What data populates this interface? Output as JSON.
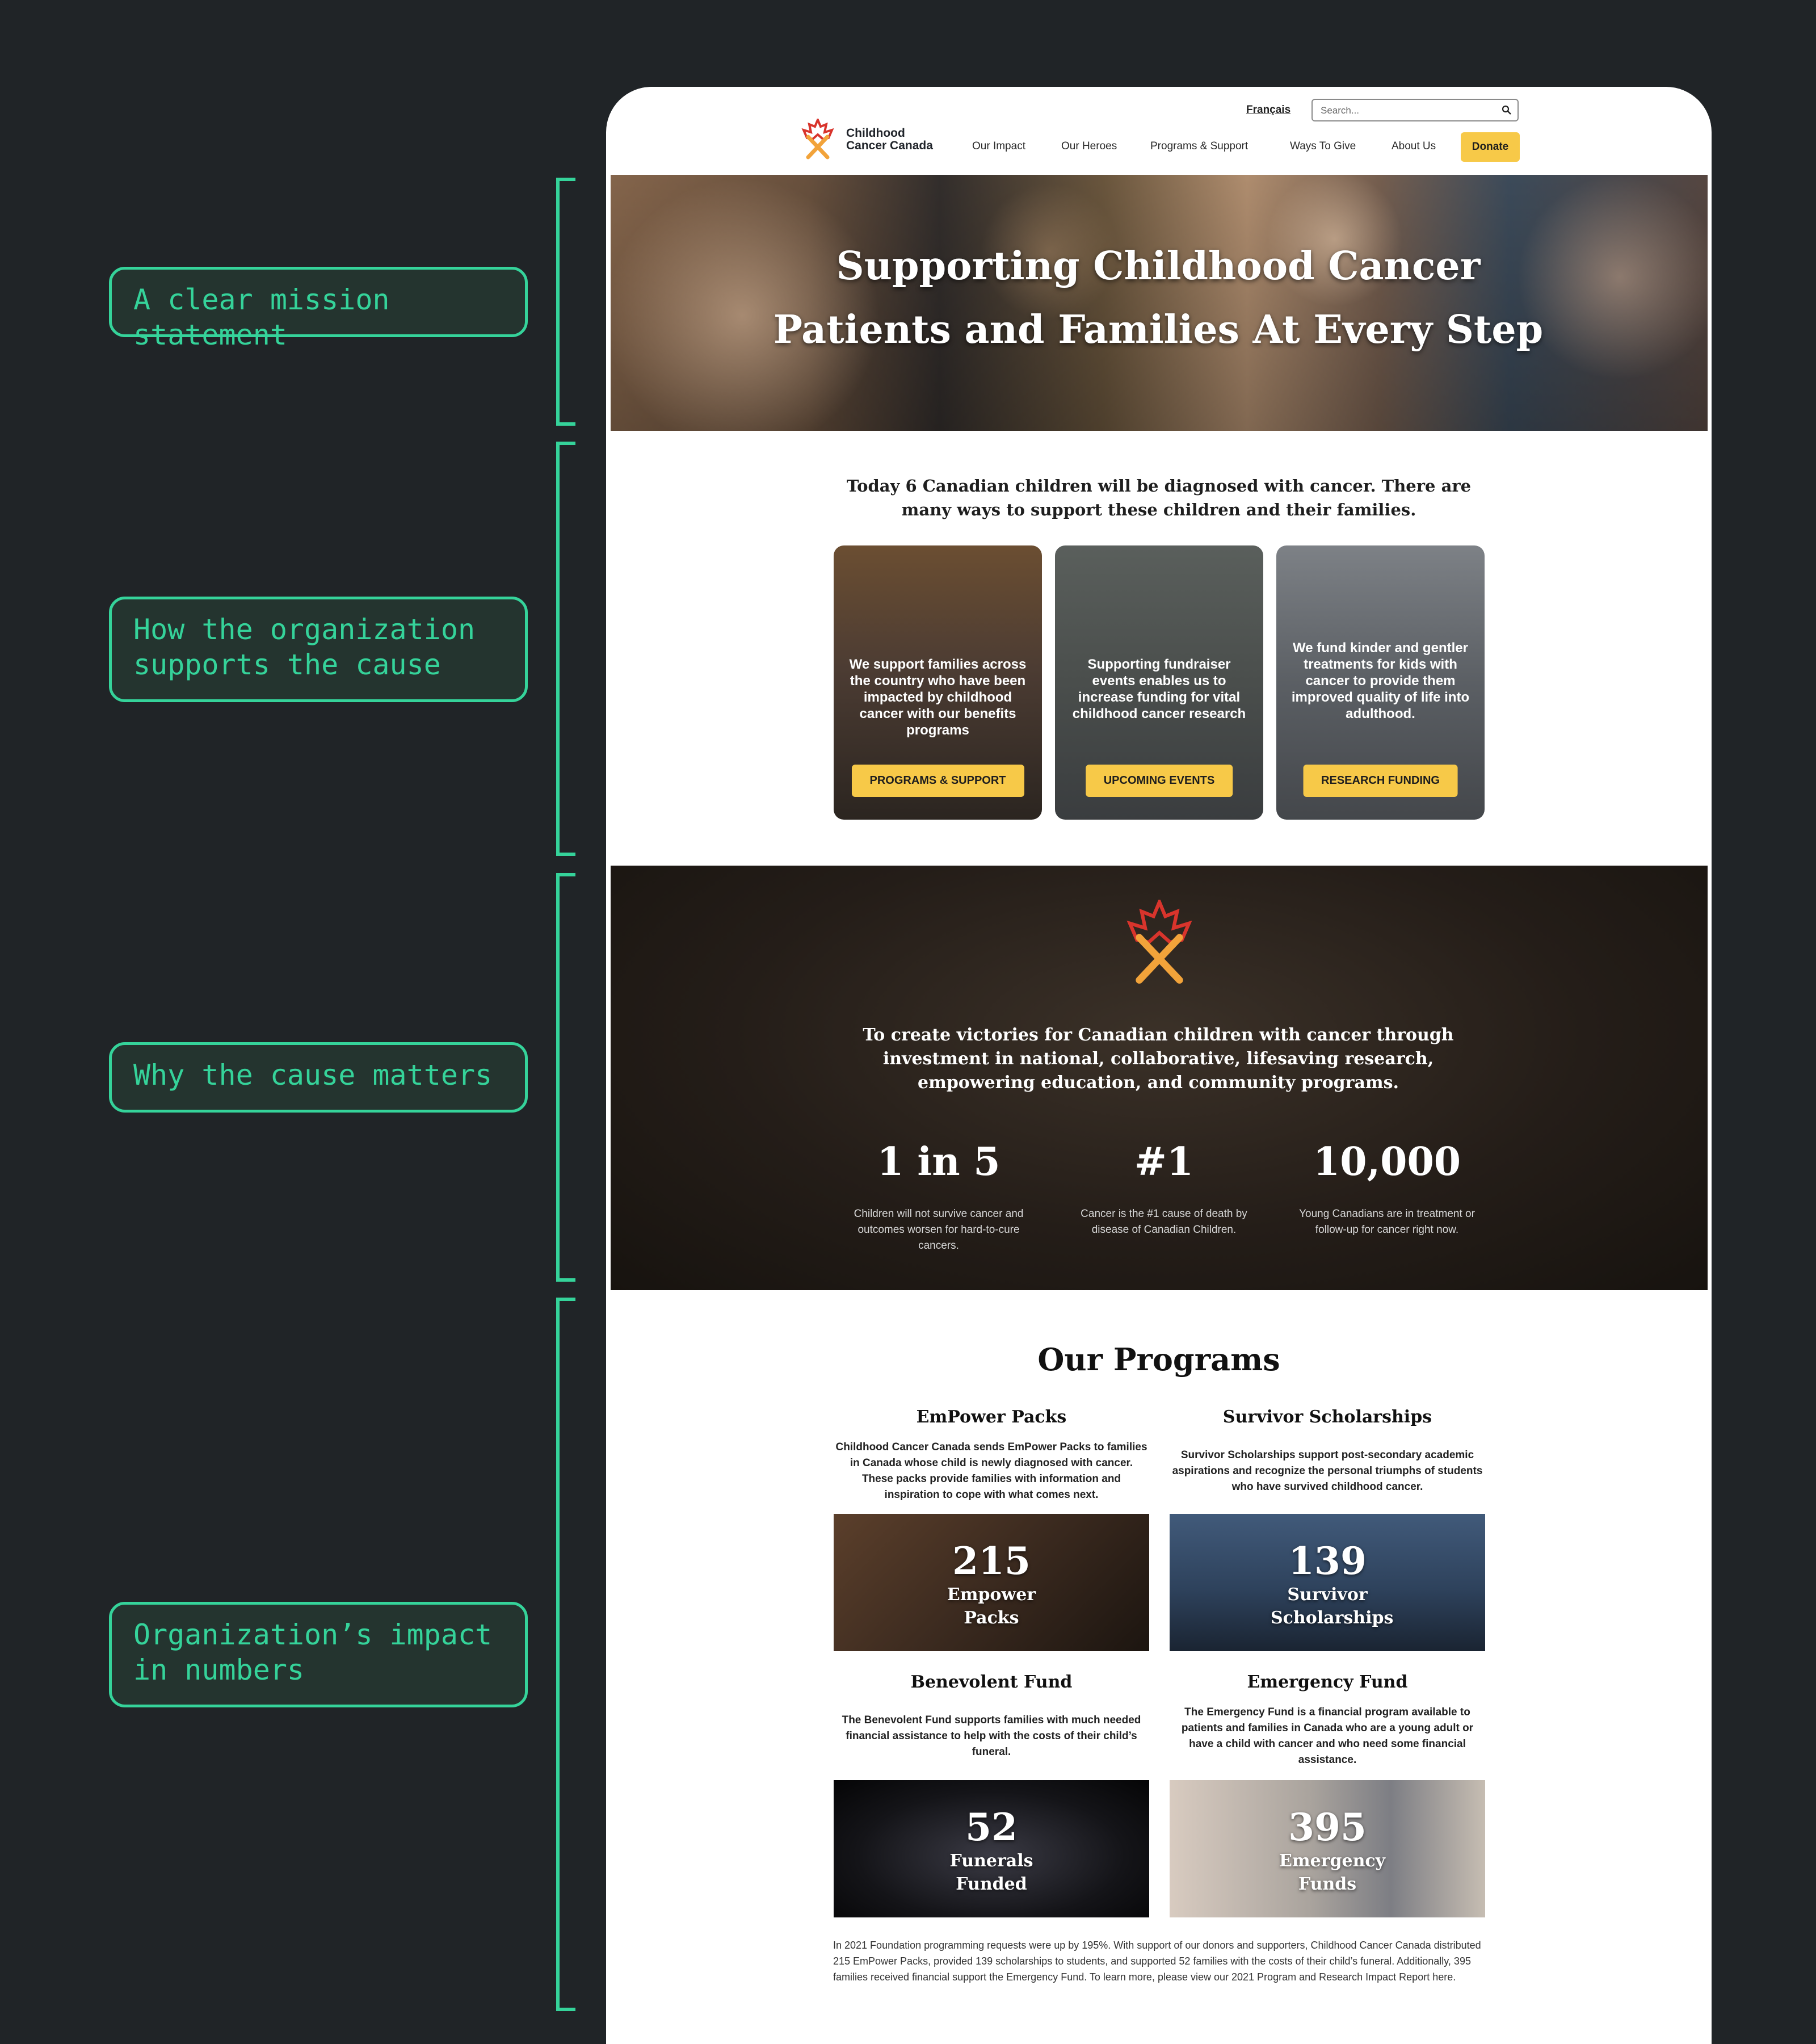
{
  "annotations": [
    {
      "label": "A clear mission statement"
    },
    {
      "label": "How the organization supports the cause"
    },
    {
      "label": "Why the cause matters"
    },
    {
      "label": "Organization’s impact in numbers"
    }
  ],
  "header": {
    "brand": {
      "line1": "Childhood",
      "line2": "Cancer Canada"
    },
    "language_link": "Français",
    "search_placeholder": "Search...",
    "nav": [
      "Our Impact",
      "Our Heroes",
      "Programs & Support",
      "Ways To Give",
      "About Us"
    ],
    "donate": "Donate"
  },
  "hero": {
    "title": "Supporting Childhood Cancer Patients and Families At Every Step"
  },
  "intro": "Today 6 Canadian children will be diagnosed with cancer. There are many ways to support these children and their families.",
  "cards": [
    {
      "text": "We support families across the country who have been impacted by childhood cancer with our benefits programs",
      "button": "PROGRAMS & SUPPORT"
    },
    {
      "text": "Supporting fundraiser events enables us to increase funding for vital childhood cancer research",
      "button": "UPCOMING EVENTS"
    },
    {
      "text": "We fund kinder and gentler treatments for kids with cancer to provide them improved quality of life into adulthood.",
      "button": "RESEARCH FUNDING"
    }
  ],
  "mission": {
    "statement": "To create victories for Canadian children with cancer through investment in national, collaborative, lifesaving research, empowering education, and community programs.",
    "stats": [
      {
        "value": "1 in 5",
        "description": "Children will not survive cancer and outcomes worsen for hard-to-cure cancers."
      },
      {
        "value": "#1",
        "description": "Cancer is the #1 cause of death by disease of Canadian Children."
      },
      {
        "value": "10,000",
        "description": "Young Canadians are in treatment or follow-up for cancer right now."
      }
    ]
  },
  "programs": {
    "heading": "Our Programs",
    "items": [
      {
        "title": "EmPower Packs",
        "description": "Childhood Cancer Canada sends EmPower Packs to families in Canada whose child is newly diagnosed with cancer. These packs provide families with information and inspiration to cope with what comes next.",
        "number": "215",
        "label": "Empower Packs"
      },
      {
        "title": "Survivor Scholarships",
        "description": "Survivor Scholarships support post-secondary academic aspirations and recognize the personal triumphs of students who have survived childhood cancer.",
        "number": "139",
        "label": "Survivor Scholarships"
      },
      {
        "title": "Benevolent Fund",
        "description": "The Benevolent Fund supports families with much needed financial assistance to help with the costs of their child’s funeral.",
        "number": "52",
        "label": "Funerals Funded"
      },
      {
        "title": "Emergency Fund",
        "description": "The Emergency Fund is a financial program available to patients and families in Canada who are a young adult or have a child with cancer and who need some financial assistance.",
        "number": "395",
        "label": "Emergency Funds"
      }
    ],
    "summary": "In 2021 Foundation programming requests were up by 195%. With support of our donors and supporters, Childhood Cancer Canada distributed 215 EmPower Packs, provided 139 scholarships to students, and supported 52 families with the costs of their child’s funeral. Additionally, 395 families received financial support the Emergency Fund. To learn more, please view our 2021 Program and Research Impact Report here."
  },
  "colors": {
    "accent": "#35d39a",
    "donate": "#f7c948",
    "page_bg": "#202427",
    "logo_red": "#d8342c",
    "logo_orange": "#f2a33a"
  }
}
